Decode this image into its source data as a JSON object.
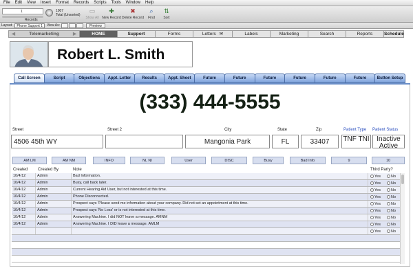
{
  "menu": [
    "File",
    "Edit",
    "View",
    "Insert",
    "Format",
    "Records",
    "Scripts",
    "Tools",
    "Window",
    "Help"
  ],
  "toolbar": {
    "record_value": "1",
    "records_label": "Records",
    "found_count": "1007",
    "found_text": "Total (Unsorted)",
    "show_all": "Show All",
    "new_record": "New Record",
    "delete_record": "Delete Record",
    "find": "Find",
    "sort": "Sort"
  },
  "layoutbar": {
    "layout_label": "Layout:",
    "layout_value": "Phone Support 1",
    "view_as": "View As:",
    "preview": "Preview"
  },
  "nav": [
    {
      "label": "Telemarketing"
    },
    {
      "label": "HOME"
    },
    {
      "label": "Support"
    },
    {
      "label": "Forms"
    },
    {
      "label": "Letters"
    },
    {
      "label": "Labels"
    },
    {
      "label": "Marketing"
    },
    {
      "label": "Search"
    },
    {
      "label": "Reports"
    },
    {
      "label": "Schedule"
    }
  ],
  "contact": {
    "name": "Robert L. Smith",
    "phone": "(333) 444-5555"
  },
  "tabs": [
    "Call Screen",
    "Script",
    "Objections",
    "Appt. Letter",
    "Results",
    "Appt. Sheet",
    "Future",
    "Future",
    "Future",
    "Future",
    "Future",
    "Future",
    "Button Setup"
  ],
  "labels": {
    "street": "Street",
    "street2": "Street 2",
    "city": "City",
    "state": "State",
    "zip": "Zip",
    "patient_type": "Patient Type",
    "patient_status": "Patient Status"
  },
  "fields": {
    "street": "4506 45th WY",
    "street2": "",
    "city": "Mangonia Park",
    "state": "FL",
    "zip": "33407",
    "patient_type": "TNF TNI",
    "patient_status": "Inactive Active"
  },
  "status_buttons": [
    "AM LM",
    "AM NM",
    "INFO",
    "NL NI",
    "User",
    "DISC",
    "Busy",
    "Bad Info",
    "9",
    "10"
  ],
  "notes_header": {
    "created": "Created",
    "created_by": "Created By",
    "note": "Note",
    "third_party": "Third Party?"
  },
  "notes": [
    {
      "created": "10/4/12",
      "by": "Admin",
      "note": "Bad Information."
    },
    {
      "created": "10/4/12",
      "by": "Admin",
      "note": "Busy, call back later."
    },
    {
      "created": "10/4/12",
      "by": "Admin",
      "note": "Current Hearing Aid User, but not interested at this time."
    },
    {
      "created": "10/4/12",
      "by": "Admin",
      "note": "Phone Disconnected."
    },
    {
      "created": "10/4/12",
      "by": "Admin",
      "note": "Prospect says 'Please send me information about your company. Did not set an appointment at this time."
    },
    {
      "created": "10/4/12",
      "by": "Admin",
      "note": "Prospect says 'No Loss' or is not interested at this time."
    },
    {
      "created": "10/4/12",
      "by": "Admin",
      "note": "Answering Machine. I did NOT leave a message. AMNM"
    },
    {
      "created": "10/4/12",
      "by": "Admin",
      "note": "Answering Machine. I DID leave a message. AMLM"
    }
  ],
  "radio": {
    "yes": "Yes",
    "no": "No"
  }
}
